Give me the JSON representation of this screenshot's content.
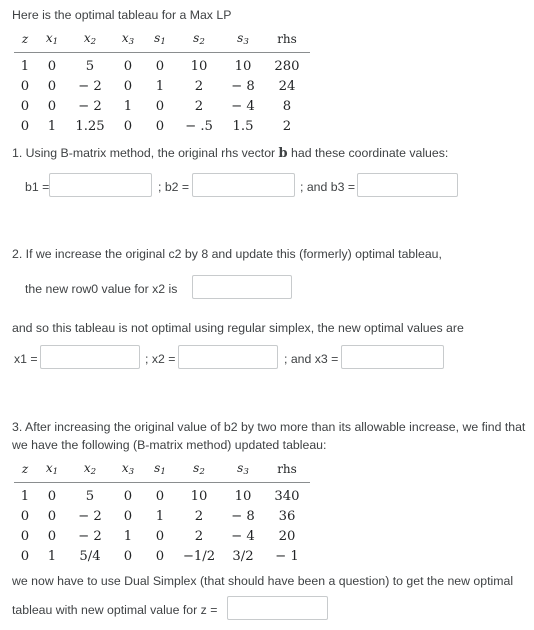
{
  "intro": {
    "text": "Here is the optimal tableau for a Max LP"
  },
  "tableau1": {
    "headers": [
      "z",
      "x1",
      "x2",
      "x3",
      "s1",
      "s2",
      "s3",
      "rhs"
    ],
    "rows": [
      [
        "1",
        "0",
        "5",
        "0",
        "0",
        "10",
        "10",
        "280"
      ],
      [
        "0",
        "0",
        "− 2",
        "0",
        "1",
        "2",
        "− 8",
        "24"
      ],
      [
        "0",
        "0",
        "− 2",
        "1",
        "0",
        "2",
        "− 4",
        "8"
      ],
      [
        "0",
        "1",
        "1.25",
        "0",
        "0",
        "− .5",
        "1.5",
        "2"
      ]
    ]
  },
  "q1": {
    "prompt_before": "1. Using B-matrix method, the original rhs vector ",
    "prompt_bold": "b",
    "prompt_after": " had these coordinate values:",
    "b1_label": "b1 =",
    "b1_value": "",
    "sep1": "; b2 =",
    "b2_value": "",
    "sep2": "; and b3 =",
    "b3_value": ""
  },
  "q2": {
    "prompt": "2. If we increase the original c2 by 8 and update this (formerly) optimal tableau,",
    "row0_label": "the new   row0   value for  x2  is",
    "row0_value": "",
    "not_optimal_text": "and so this tableau is not optimal using regular simplex, the new optimal values are",
    "x1_label": "x1 =",
    "x1_value": "",
    "sep1": "; x2 =",
    "x2_value": "",
    "sep2": "; and x3 =",
    "x3_value": ""
  },
  "q3": {
    "prompt_line1": "3.  After  increasing the original value of  b2  by two more than its allowable increase, we find that",
    "prompt_line2": "we have the following (B-matrix method) updated tableau:",
    "tableau2": {
      "headers": [
        "z",
        "x1",
        "x2",
        "x3",
        "s1",
        "s2",
        "s3",
        "rhs"
      ],
      "rows": [
        [
          "1",
          "0",
          "5",
          "0",
          "0",
          "10",
          "10",
          "340"
        ],
        [
          "0",
          "0",
          "− 2",
          "0",
          "1",
          "2",
          "− 8",
          "36"
        ],
        [
          "0",
          "0",
          "− 2",
          "1",
          "0",
          "2",
          "− 4",
          "20"
        ],
        [
          "0",
          "1",
          "5/4",
          "0",
          "0",
          "−1/2",
          "3/2",
          "− 1"
        ]
      ]
    },
    "closing_line1": "we now have to use Dual Simplex (that should have been a question) to get the new optimal",
    "closing_line2": "tableau  with  new optimal value for z  =",
    "z_value": ""
  }
}
